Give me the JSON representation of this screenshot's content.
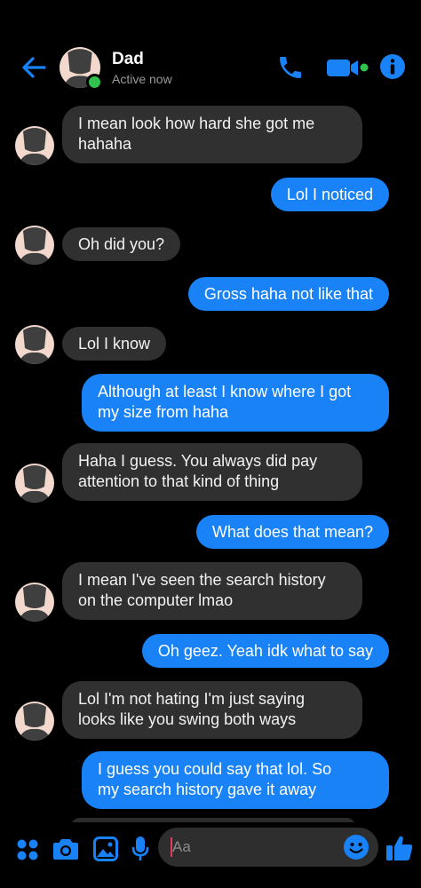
{
  "header": {
    "contact_name": "Dad",
    "status": "Active now",
    "icons": [
      "back-arrow-icon",
      "phone-icon",
      "video-camera-icon",
      "info-icon"
    ],
    "accent_color": "#1a82f7",
    "online_color": "#31c24d"
  },
  "messages": [
    {
      "from": "them",
      "text": "I mean look how hard she got me\nhahaha"
    },
    {
      "from": "me",
      "text": "Lol I noticed"
    },
    {
      "from": "them",
      "text": "Oh did you?"
    },
    {
      "from": "me",
      "text": "Gross haha not like that"
    },
    {
      "from": "them",
      "text": "Lol I know"
    },
    {
      "from": "me",
      "text": "Although at least I know where I got\nmy size from haha"
    },
    {
      "from": "them",
      "text": "Haha I guess. You always did pay\nattention to that kind of thing"
    },
    {
      "from": "me",
      "text": "What does that mean?"
    },
    {
      "from": "them",
      "text": "I mean I've seen the search history\non the computer lmao"
    },
    {
      "from": "me",
      "text": "Oh geez. Yeah idk what to say"
    },
    {
      "from": "them",
      "text": "Lol I'm not hating I'm just saying\nlooks like you swing both ways"
    },
    {
      "from": "me",
      "text": "I guess you could say that lol. So\nmy search history gave it away"
    }
  ],
  "composer": {
    "placeholder": "Aa",
    "icons": [
      "apps-grid-icon",
      "camera-icon",
      "gallery-icon",
      "microphone-icon",
      "emoji-icon",
      "thumbs-up-icon"
    ]
  }
}
